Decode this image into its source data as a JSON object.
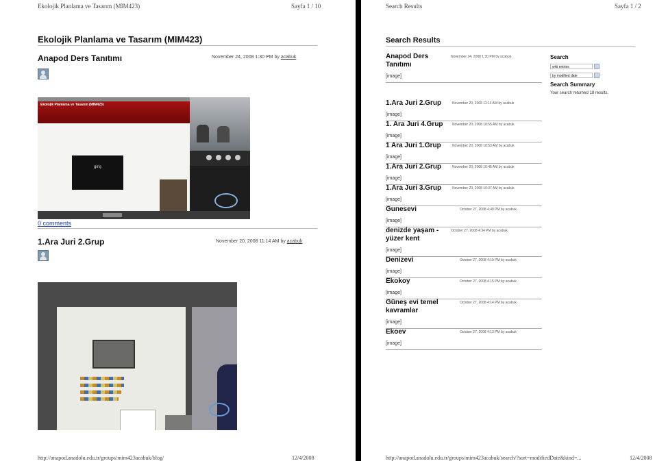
{
  "left_page": {
    "header_left": "Ekolojik Planlama ve Tasarım (MIM423)",
    "header_right": "Sayfa 1 / 10",
    "title": "Ekolojik Planlama ve Tasarım (MIM423)",
    "posts": [
      {
        "title": "Anapod Ders Tanıtımı",
        "date": "November 24, 2008 1:30 PM",
        "by": "by",
        "author": "acabuk",
        "comments_link": "0 comments",
        "slide_text": "giriş",
        "window_title": "Ekolojik Planlama ve Tasarım (MIM423)"
      },
      {
        "title": "1.Ara Juri 2.Grup",
        "date": "November 20, 2008 11:14 AM",
        "by": "by",
        "author": "acabuk"
      }
    ],
    "footer_url": "http://anapod.anadolu.edu.tr/groups/mim423acabuk/blog/",
    "footer_date": "12/4/2008"
  },
  "right_page": {
    "header_left": "Search Results",
    "header_right": "Sayfa 1 / 2",
    "title": "Search Results",
    "image_placeholder": "[image]",
    "results": [
      {
        "title": "Anapod Ders Tanıtımı",
        "date": "November 24, 2008 1:30 PM",
        "by": "by",
        "author": "acabuk"
      },
      {
        "title": "1.Ara Juri 2.Grup",
        "date": "November 20, 2008 11:14 AM",
        "by": "by",
        "author": "acabuk"
      },
      {
        "title": "1. Ara Juri 4.Grup",
        "date": "November 20, 2008 10:55 AM",
        "by": "by",
        "author": "acabuk"
      },
      {
        "title": "1 Ara Juri 1.Grup",
        "date": "November 20, 2008 10:53 AM",
        "by": "by",
        "author": "acabuk"
      },
      {
        "title": "1.Ara Juri 2.Grup",
        "date": "November 20, 2008 10:46 AM",
        "by": "by",
        "author": "acabuk"
      },
      {
        "title": "1.Ara Juri 3.Grup",
        "date": "November 20, 2008 10:37 AM",
        "by": "by",
        "author": "acabuk"
      },
      {
        "title": "Gunesevi",
        "date": "October 27, 2008 4:40 PM",
        "by": "by",
        "author": "acabuk"
      },
      {
        "title": "denizde yaşam - yüzer kent",
        "date": "October 27, 2008 4:34 PM",
        "by": "by",
        "author": "acabuk"
      },
      {
        "title": "Denizevi",
        "date": "October 27, 2008 4:19 PM",
        "by": "by",
        "author": "acabuk"
      },
      {
        "title": "Ekokoy",
        "date": "October 27, 2008 4:15 PM",
        "by": "by",
        "author": "acabuk"
      },
      {
        "title": "Güneş evi temel kavramlar",
        "date": "October 27, 2008 4:14 PM",
        "by": "by",
        "author": "acabuk"
      },
      {
        "title": "Ekoev",
        "date": "October 27, 2008 4:13 PM",
        "by": "by",
        "author": "acabuk"
      }
    ],
    "sidebar": {
      "search_heading": "Search",
      "select_entries": "wiki entries",
      "select_sort": "by modified date",
      "summary_heading": "Search Summary",
      "summary_text": "Your search returned 18 results."
    },
    "footer_url": "http://anapod.anadolu.edu.tr/groups/mim423acabuk/search/?sort=modifiedDate&kind=...",
    "footer_date": "12/4/2008"
  }
}
